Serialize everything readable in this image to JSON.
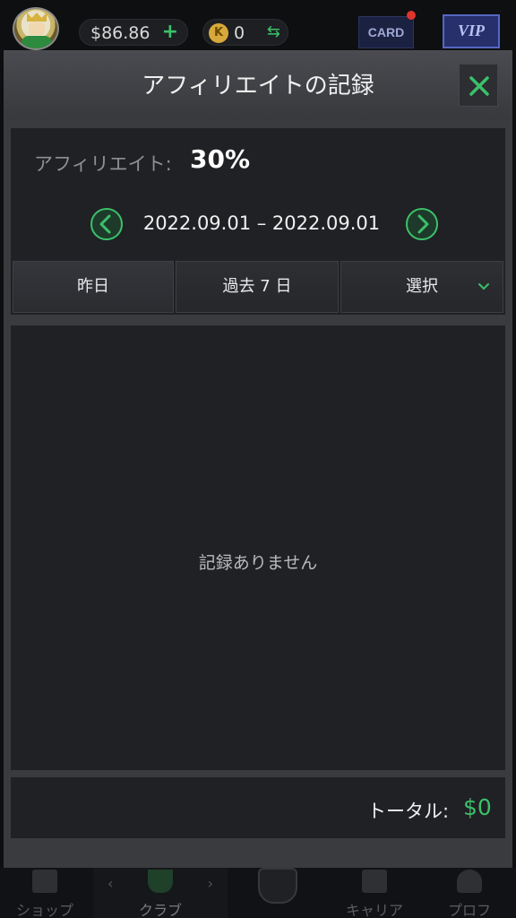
{
  "topbar": {
    "balance": "$86.86",
    "balance_add": "+",
    "coin_symbol": "K",
    "coin_count": "0",
    "swap_symbol": "⇆",
    "card_label": "CARD",
    "vip_label": "VIP"
  },
  "modal": {
    "title": "アフィリエイトの記録",
    "affiliate_label": "アフィリエイト:",
    "affiliate_rate": "30%",
    "date_range": "2022.09.01 – 2022.09.01",
    "tabs": {
      "yesterday": "昨日",
      "last7days": "過去 7 日",
      "select": "選択"
    },
    "empty_message": "記録ありません",
    "total_label": "トータル:",
    "total_value": "$0"
  },
  "bottomnav": {
    "shop": "ショップ",
    "club": "クラブ",
    "career": "キャリア",
    "profile": "プロフ"
  },
  "colors": {
    "accent_green": "#3bc16a",
    "modal_bg": "#3a3b3f",
    "panel_bg": "#202124"
  }
}
